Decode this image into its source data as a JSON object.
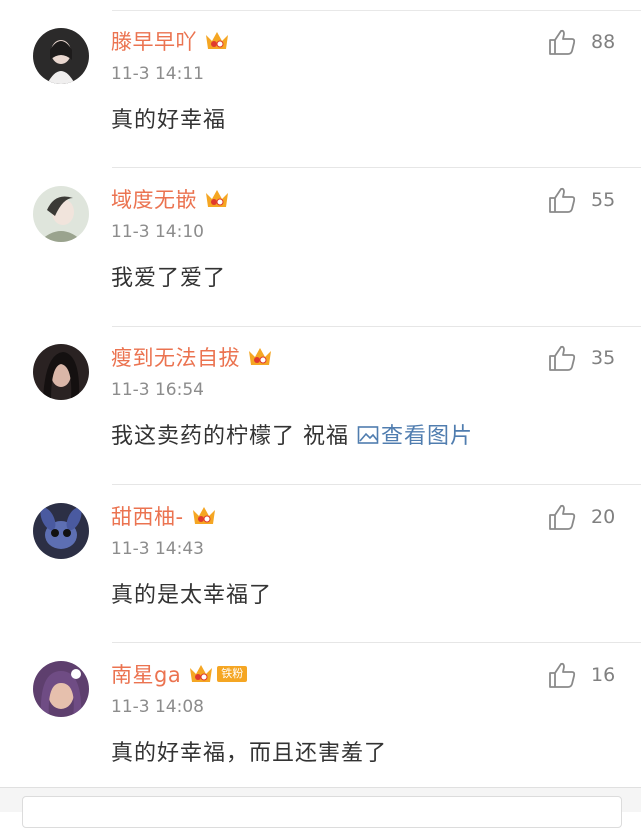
{
  "comments": [
    {
      "username": "滕早早吖",
      "time": "11-3 14:11",
      "text": "真的好幸福",
      "likes": "88",
      "avatar_color": "#d9c9c2"
    },
    {
      "username": "域度无嵌",
      "time": "11-3 14:10",
      "text": "我爱了爱了",
      "likes": "55",
      "avatar_color": "#c9d2c4"
    },
    {
      "username": "瘦到无法自拔",
      "time": "11-3 16:54",
      "text": "我这卖药的柠檬了 祝福 ",
      "link_text": "查看图片",
      "likes": "35",
      "avatar_color": "#3a3030"
    },
    {
      "username": "甜西柚-",
      "time": "11-3 14:43",
      "text": "真的是太幸福了",
      "likes": "20",
      "avatar_color": "#3b3f5c"
    },
    {
      "username": "南星ga",
      "badge": "铁粉",
      "time": "11-3 14:08",
      "text": "真的好幸福，而且还害羞了",
      "likes": "16",
      "avatar_color": "#6a4b7a"
    }
  ],
  "colors": {
    "username": "#eb7350",
    "link": "#507daf",
    "meta": "#8c8c8c",
    "crown": "#f5a623"
  }
}
